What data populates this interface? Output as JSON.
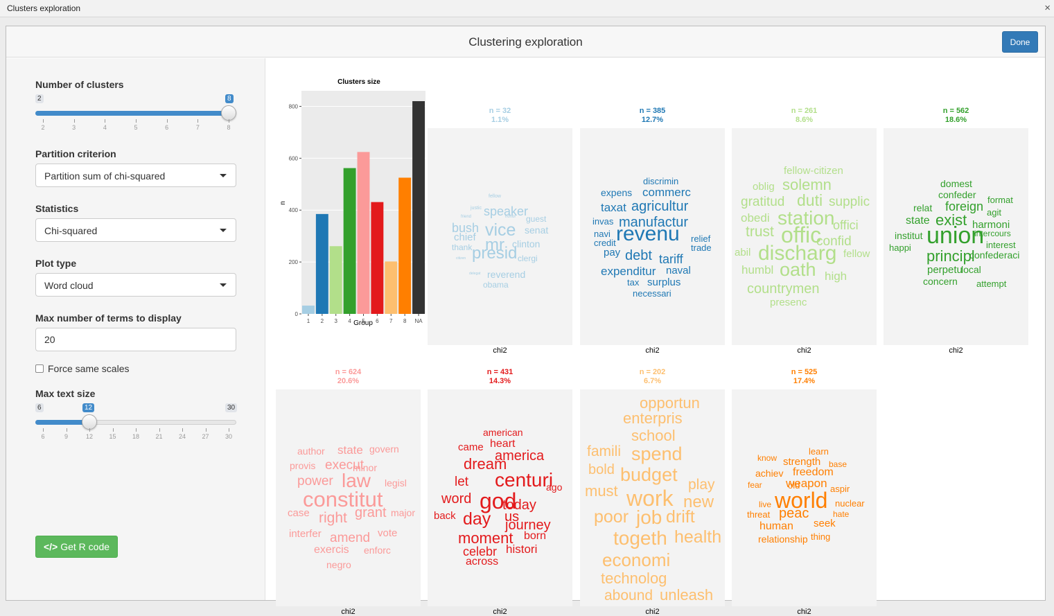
{
  "window": {
    "title": "Clusters exploration",
    "close_glyph": "×"
  },
  "dialog": {
    "title": "Clustering exploration",
    "done_label": "Done"
  },
  "sidebar": {
    "clusters": {
      "label": "Number of clusters",
      "min": "2",
      "max": "8",
      "value": "8",
      "ticks": [
        "2",
        "3",
        "4",
        "5",
        "6",
        "7",
        "8"
      ]
    },
    "partition": {
      "label": "Partition criterion",
      "value": "Partition sum of chi-squared"
    },
    "statistics": {
      "label": "Statistics",
      "value": "Chi-squared"
    },
    "plot_type": {
      "label": "Plot type",
      "value": "Word cloud"
    },
    "max_terms": {
      "label": "Max number of terms to display",
      "value": "20"
    },
    "same_scales": {
      "label": "Force same scales",
      "checked": false
    },
    "text_size": {
      "label": "Max text size",
      "min": "6",
      "max": "30",
      "value": "12",
      "ticks": [
        "6",
        "9",
        "12",
        "15",
        "18",
        "21",
        "24",
        "27",
        "30"
      ]
    },
    "r_code_label": "Get R code"
  },
  "chart_data": {
    "type": "bar",
    "title": "Clusters size",
    "xlabel": "Group",
    "ylabel": "n",
    "categories": [
      "1",
      "2",
      "3",
      "4",
      "5",
      "6",
      "7",
      "8",
      "NA"
    ],
    "values": [
      32,
      385,
      261,
      562,
      624,
      431,
      202,
      525,
      820
    ],
    "colors": [
      "#a6cee3",
      "#1f78b4",
      "#b2df8a",
      "#33a02c",
      "#fb9a99",
      "#e31a1c",
      "#fdbf6f",
      "#ff7f00",
      "#333333"
    ],
    "yticks": [
      "0",
      "200",
      "400",
      "600",
      "800"
    ],
    "ylim": [
      0,
      860
    ],
    "grid": true
  },
  "clusters": [
    {
      "n": "n = 32",
      "pct": "1.1%",
      "color": "#a6cee3",
      "footer": "chi2",
      "words": [
        "fellow",
        "justic",
        "speaker",
        "friend",
        "honor",
        "guest",
        "bush",
        "vice",
        "senat",
        "chief",
        "mr",
        "clinton",
        "thank",
        "presid",
        "clergi",
        "citizen",
        "reverend",
        "delegat",
        "obama"
      ]
    },
    {
      "n": "n = 385",
      "pct": "12.7%",
      "color": "#1f78b4",
      "footer": "chi2",
      "words": [
        "discrimin",
        "expens",
        "commerc",
        "taxat",
        "agricultur",
        "invas",
        "manufactur",
        "navi",
        "revenu",
        "credit",
        "relief",
        "trade",
        "pay",
        "debt",
        "tariff",
        "expenditur",
        "naval",
        "tax",
        "surplus",
        "necessari"
      ]
    },
    {
      "n": "n = 261",
      "pct": "8.6%",
      "color": "#b2df8a",
      "footer": "chi2",
      "words": [
        "fellow-citizen",
        "oblig",
        "solemn",
        "gratitud",
        "duti",
        "supplic",
        "obedi",
        "station",
        "trust",
        "offic",
        "offici",
        "confid",
        "abil",
        "discharg",
        "fellow",
        "humbl",
        "oath",
        "high",
        "countrymen",
        "presenc"
      ]
    },
    {
      "n": "n = 562",
      "pct": "18.6%",
      "color": "#33a02c",
      "footer": "chi2",
      "words": [
        "domest",
        "confeder",
        "format",
        "relat",
        "foreign",
        "agit",
        "state",
        "exist",
        "harmoni",
        "institut",
        "union",
        "intercours",
        "happi",
        "interest",
        "principl",
        "confederaci",
        "perpetu",
        "local",
        "concern",
        "attempt"
      ]
    },
    {
      "n": "n = 624",
      "pct": "20.6%",
      "color": "#fb9a99",
      "footer": "chi2",
      "words": [
        "author",
        "state",
        "govern",
        "provis",
        "execut",
        "minor",
        "power",
        "law",
        "legisl",
        "constitut",
        "case",
        "right",
        "grant",
        "major",
        "interfer",
        "amend",
        "vote",
        "exercis",
        "enforc",
        "negro"
      ]
    },
    {
      "n": "n = 431",
      "pct": "14.3%",
      "color": "#e31a1c",
      "footer": "chi2",
      "words": [
        "american",
        "came",
        "heart",
        "america",
        "dream",
        "let",
        "centuri",
        "ago",
        "word",
        "god",
        "today",
        "back",
        "day",
        "us",
        "journey",
        "moment",
        "born",
        "celebr",
        "histori",
        "across"
      ]
    },
    {
      "n": "n = 202",
      "pct": "6.7%",
      "color": "#fdbf6f",
      "footer": "chi2",
      "words": [
        "opportun",
        "enterpris",
        "school",
        "famili",
        "spend",
        "bold",
        "budget",
        "must",
        "play",
        "work",
        "new",
        "poor",
        "job",
        "drift",
        "togeth",
        "health",
        "economi",
        "technolog",
        "abound",
        "unleash"
      ]
    },
    {
      "n": "n = 525",
      "pct": "17.4%",
      "color": "#ff7f00",
      "footer": "chi2",
      "words": [
        "learn",
        "know",
        "strength",
        "base",
        "achiev",
        "freedom",
        "fear",
        "old",
        "weapon",
        "aspir",
        "live",
        "world",
        "nuclear",
        "threat",
        "peac",
        "hate",
        "human",
        "seek",
        "relationship",
        "thing"
      ]
    }
  ]
}
